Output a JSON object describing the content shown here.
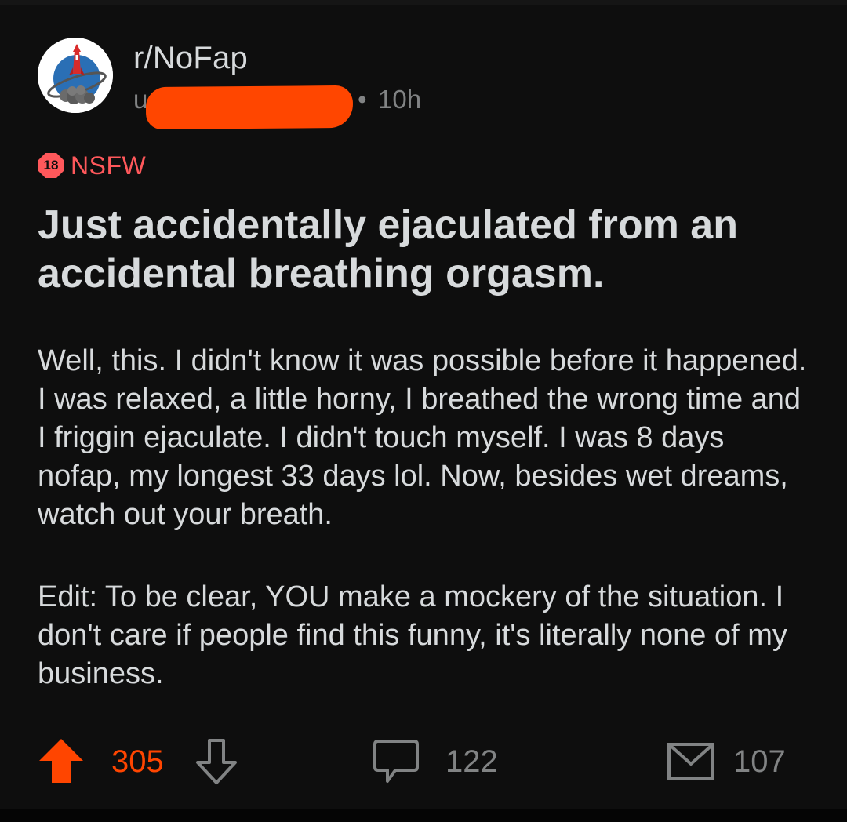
{
  "post": {
    "subreddit": "r/NoFap",
    "username_visible": "u",
    "meta_separator": "•",
    "time_ago": "10h",
    "nsfw": {
      "badge_text": "18",
      "label": "NSFW"
    },
    "title": "Just accidentally ejaculated from an accidental breathing orgasm.",
    "body_paragraphs": [
      "Well, this. I didn't know it was possible before it happened. I was relaxed, a little horny, I breathed the wrong time and I friggin ejaculate. I didn't touch myself. I was 8 days nofap, my longest 33 days lol. Now, besides wet dreams, watch out your breath.",
      "Edit: To be clear, YOU make a mockery of the situation. I don't care if people find this funny, it's literally none of my business."
    ]
  },
  "actions": {
    "score": "305",
    "upvote_state": "upvoted",
    "comments": "122",
    "shares": "107"
  },
  "icons": {
    "avatar": "subreddit-rocket-icon",
    "upvote": "arrow-up-icon",
    "downvote": "arrow-down-icon",
    "comment": "speech-bubble-icon",
    "share": "envelope-icon",
    "nsfw": "octagon-18-icon"
  },
  "colors": {
    "background": "#0e0e0e",
    "text": "#d7dadc",
    "muted": "#818384",
    "accent_upvote": "#ff4500",
    "nsfw": "#ff585b",
    "redaction": "#ff4600"
  }
}
